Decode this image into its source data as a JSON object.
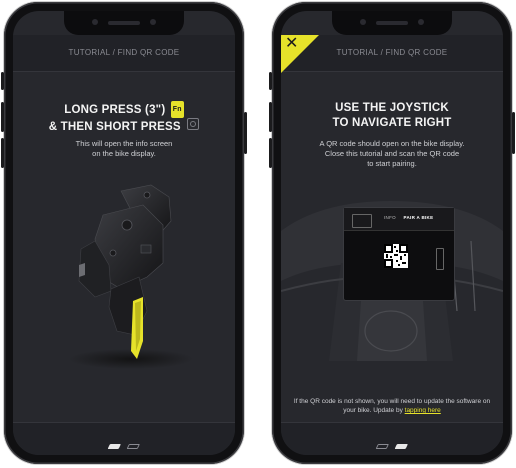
{
  "left_phone": {
    "breadcrumb": "TUTORIAL / FIND QR CODE",
    "heading_line1_text": "LONG PRESS (3\")",
    "heading_line1_badge": "Fn",
    "heading_line2_text": "& THEN SHORT PRESS",
    "body": "This will open the info screen\non the bike display.",
    "image_icon": "handlebar-controller-image",
    "pagination": {
      "current": 1,
      "total": 2
    }
  },
  "right_phone": {
    "close_icon": "close-x-icon",
    "breadcrumb": "TUTORIAL / FIND QR CODE",
    "heading_line1": "USE THE JOYSTICK",
    "heading_line2": "TO NAVIGATE RIGHT",
    "body": "A QR code should open on the bike display.\nClose this tutorial and scan the QR code\nto start pairing.",
    "display_info_label": "INFO",
    "display_pair_label": "PAIR A BIKE",
    "update_note_text": "If the QR code is not shown, you will need to update the software on your bike. Update by",
    "update_link": "tapping here",
    "image_icon": "bike-handlebar-display-image",
    "pagination": {
      "current": 2,
      "total": 2
    }
  },
  "colors": {
    "accent": "#e6e22a",
    "screen_bg": "#27282d",
    "bar_bg": "#212227",
    "phone_body": "#101012"
  }
}
